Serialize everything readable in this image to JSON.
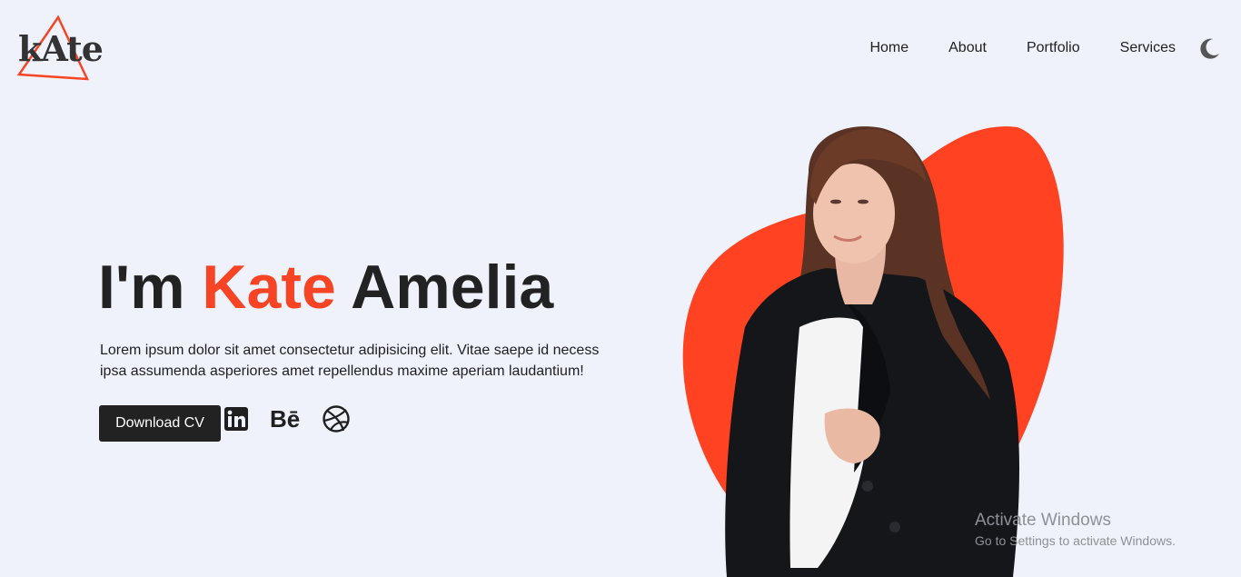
{
  "brand": {
    "logo_text": "kAte",
    "accent_color": "#f74425"
  },
  "nav": {
    "items": [
      {
        "label": "Home"
      },
      {
        "label": "About"
      },
      {
        "label": "Portfolio"
      },
      {
        "label": "Services"
      }
    ],
    "theme_toggle_icon": "moon-icon"
  },
  "hero": {
    "greeting": "I'm ",
    "first_name": "Kate",
    "last_name": " Amelia",
    "description": "Lorem ipsum dolor sit amet consectetur adipisicing elit. Vitae saepe id necess ipsa assumenda asperiores amet repellendus maxime aperiam laudantium!",
    "download_label": "Download CV",
    "social": [
      {
        "icon": "linkedin-icon"
      },
      {
        "icon": "behance-icon",
        "text": "Bē"
      },
      {
        "icon": "dribbble-icon"
      }
    ],
    "portrait_icon": "portrait-image"
  },
  "watermark": {
    "title": "Activate Windows",
    "subtitle": "Go to Settings to activate Windows."
  }
}
